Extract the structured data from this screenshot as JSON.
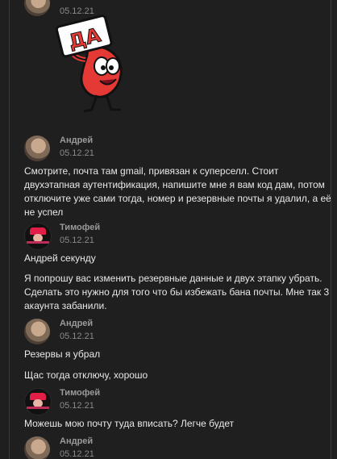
{
  "messages": [
    {
      "author": "",
      "date": "05.12.21",
      "type": "sticker"
    },
    {
      "author": "Андрей",
      "date": "05.12.21",
      "texts": [
        "Смотрите, почта там gmail, привязан к суперселл. Стоит двухэтапная аутентификация, напишите мне я вам код дам, потом отключите уже сами тогда, номер и резервные почты я удалил, а её не успел"
      ]
    },
    {
      "author": "Тимофей",
      "date": "05.12.21",
      "texts": [
        "Андрей секунду",
        "Я попрошу вас изменить резервные данные и двух этапку убрать. Сделать это нужно для того что бы избежать бана почты. Мне так 3 акаунта забанили."
      ]
    },
    {
      "author": "Андрей",
      "date": "05.12.21",
      "texts": [
        "Резервы я убрал",
        "Щас тогда отключу, хорошо"
      ]
    },
    {
      "author": "Тимофей",
      "date": "05.12.21",
      "texts": [
        "Можешь мою почту туда вписать? Легче будет"
      ]
    },
    {
      "author": "Андрей",
      "date": "05.12.21"
    }
  ],
  "sticker": {
    "caption": "ДА"
  }
}
